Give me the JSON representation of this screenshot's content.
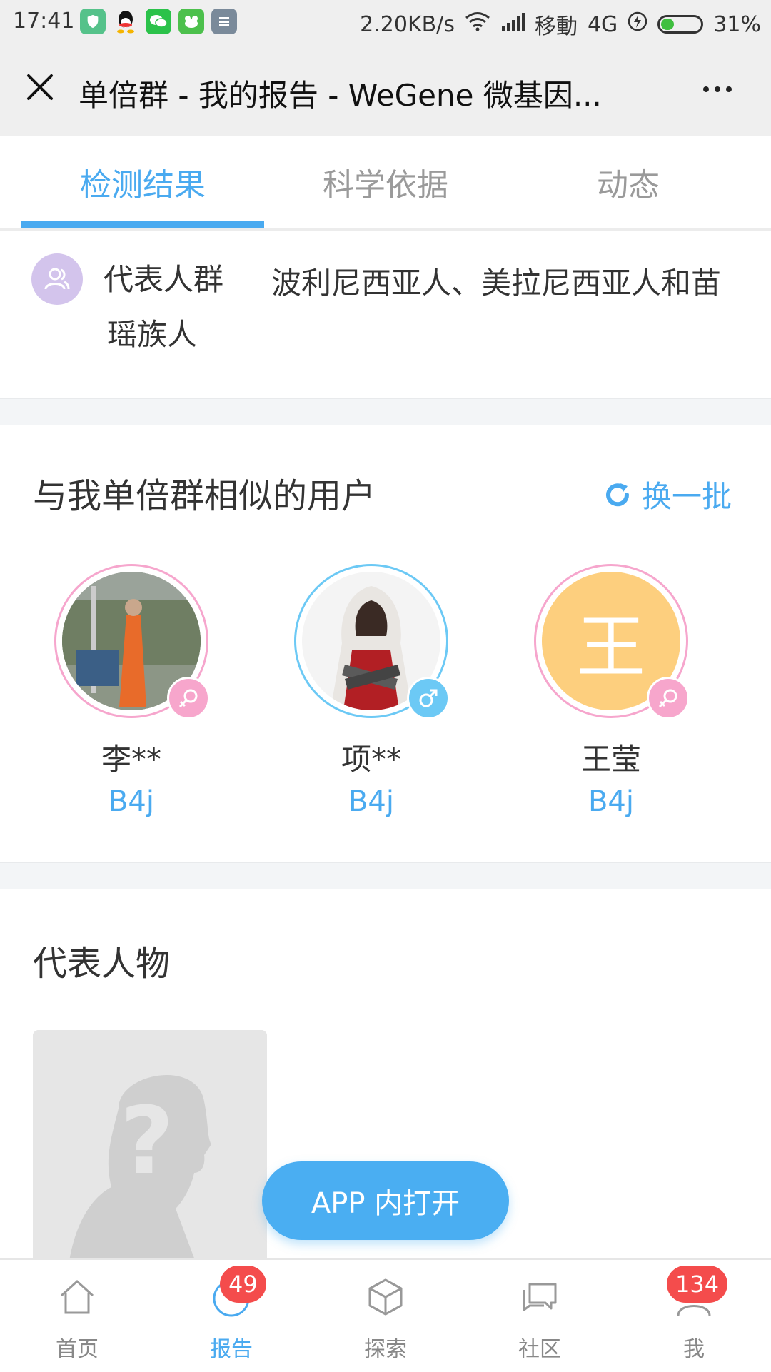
{
  "status_bar": {
    "time": "17:41",
    "network_speed": "2.20KB/s",
    "carrier": "移動",
    "network_type": "4G",
    "battery": "31%",
    "battery_level": 0.31,
    "notification_icons": [
      "shield-icon",
      "qq-icon",
      "wechat-icon",
      "frog-icon",
      "app-icon"
    ]
  },
  "title_bar": {
    "title": "单倍群 - 我的报告 - WeGene 微基因..."
  },
  "tabs": [
    {
      "label": "检测结果",
      "active": true
    },
    {
      "label": "科学依据",
      "active": false
    },
    {
      "label": "动态",
      "active": false
    }
  ],
  "representative_group": {
    "label": "代表人群",
    "value": "波利尼西亚人、美拉尼西亚人和苗瑶族人"
  },
  "similar_users": {
    "title": "与我单倍群相似的用户",
    "refresh_label": "换一批",
    "users": [
      {
        "name": "李**",
        "haplogroup": "B4j",
        "gender": "female",
        "avatar_type": "photo-landscape"
      },
      {
        "name": "项**",
        "haplogroup": "B4j",
        "gender": "male",
        "avatar_type": "photo-hooded-figure"
      },
      {
        "name": "王莹",
        "haplogroup": "B4j",
        "gender": "female",
        "avatar_type": "initial",
        "avatar_initial": "王",
        "avatar_color": "#fdcf7e"
      }
    ]
  },
  "representative_person": {
    "title": "代表人物"
  },
  "open_app_label": "APP 内打开",
  "bottom_nav": [
    {
      "label": "首页",
      "icon": "home-icon",
      "active": false,
      "badge": ""
    },
    {
      "label": "报告",
      "icon": "report-icon",
      "active": true,
      "badge": "49"
    },
    {
      "label": "探索",
      "icon": "cube-icon",
      "active": false,
      "badge": ""
    },
    {
      "label": "社区",
      "icon": "chat-icon",
      "active": false,
      "badge": ""
    },
    {
      "label": "我",
      "icon": "user-icon",
      "active": false,
      "badge": "134"
    }
  ],
  "colors": {
    "accent": "#4aaaf0",
    "female": "#f7a6cc",
    "male": "#6cc9f5",
    "badge": "#f44c4c"
  }
}
